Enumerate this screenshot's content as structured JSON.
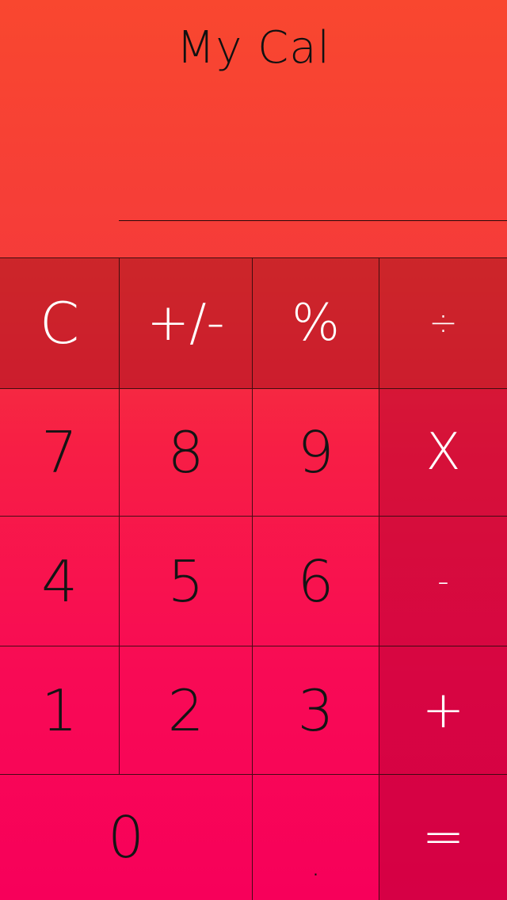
{
  "app": {
    "title": "My Cal",
    "display_value": ""
  },
  "colors": {
    "background_top": "#F9472F",
    "background_bottom": "#F7005A",
    "function_row": "#C8232F",
    "operator_column": "#C9003F",
    "digit_text": "#141414",
    "operator_text": "#FFFFFF"
  },
  "keys": {
    "clear": "C",
    "toggle_sign": "+/-",
    "percent": "%",
    "divide": "÷",
    "seven": "7",
    "eight": "8",
    "nine": "9",
    "multiply": "X",
    "four": "4",
    "five": "5",
    "six": "6",
    "subtract": "-",
    "one": "1",
    "two": "2",
    "three": "3",
    "add": "+",
    "zero": "0",
    "decimal": ".",
    "equals": "="
  }
}
